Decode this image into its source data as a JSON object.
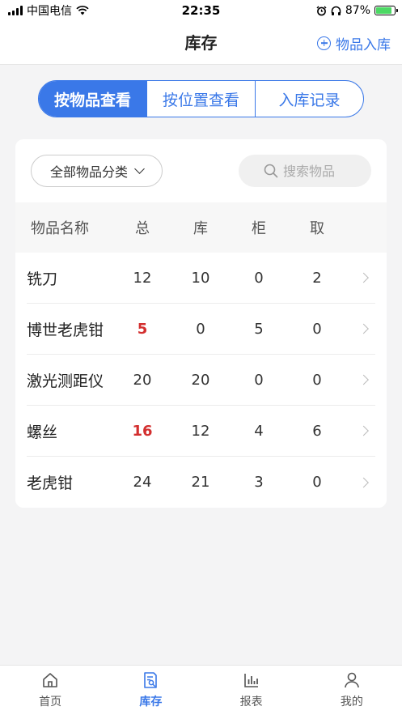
{
  "status_bar": {
    "carrier": "中国电信",
    "time": "22:35",
    "battery_percent": "87%",
    "battery_level": 0.87
  },
  "nav": {
    "title": "库存",
    "action_label": "物品入库"
  },
  "segment": {
    "tabs": [
      "按物品查看",
      "按位置查看",
      "入库记录"
    ],
    "active_index": 0
  },
  "filter": {
    "category_label": "全部物品分类",
    "search_placeholder": "搜索物品"
  },
  "table": {
    "headers": [
      "物品名称",
      "总",
      "库",
      "柜",
      "取"
    ],
    "rows": [
      {
        "name": "铣刀",
        "total": "12",
        "stock": "10",
        "cabinet": "0",
        "taken": "2",
        "warning": false
      },
      {
        "name": "博世老虎钳",
        "total": "5",
        "stock": "0",
        "cabinet": "5",
        "taken": "0",
        "warning": true
      },
      {
        "name": "激光测距仪",
        "total": "20",
        "stock": "20",
        "cabinet": "0",
        "taken": "0",
        "warning": false
      },
      {
        "name": "螺丝",
        "total": "16",
        "stock": "12",
        "cabinet": "4",
        "taken": "6",
        "warning": true
      },
      {
        "name": "老虎钳",
        "total": "24",
        "stock": "21",
        "cabinet": "3",
        "taken": "0",
        "warning": false
      }
    ]
  },
  "tab_bar": {
    "items": [
      {
        "label": "首页",
        "icon": "home-icon"
      },
      {
        "label": "库存",
        "icon": "inventory-icon"
      },
      {
        "label": "报表",
        "icon": "chart-icon"
      },
      {
        "label": "我的",
        "icon": "user-icon"
      }
    ],
    "active_index": 1
  },
  "colors": {
    "accent": "#3a78e8",
    "warning": "#d32f2f",
    "battery_fill": "#4cd964"
  }
}
